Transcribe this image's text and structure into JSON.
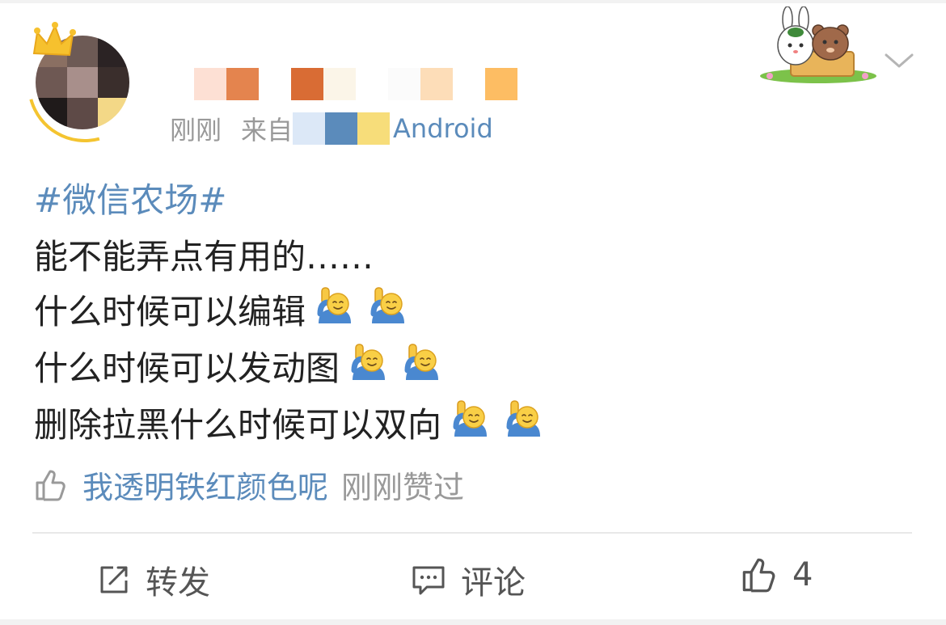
{
  "post": {
    "time": "刚刚",
    "source_prefix": "来自",
    "source_device": "Android",
    "topic": "#微信农场#",
    "lines": [
      "能不能弄点有用的……",
      "什么时候可以编辑",
      "什么时候可以发动图",
      "删除拉黑什么时候可以双向"
    ],
    "emoji_per_line": [
      0,
      2,
      2,
      2
    ],
    "emoji_name": "raising-hand-emoji"
  },
  "likes": {
    "liker": "我透明铁红颜色呢",
    "when": "刚刚赞过"
  },
  "actions": {
    "repost_label": "转发",
    "comment_label": "评论",
    "like_count": "4"
  },
  "colors": {
    "link": "#5b8bbb",
    "meta": "#999999",
    "text": "#222222",
    "action": "#555555"
  },
  "mosaic": {
    "avatar": [
      "#8a6f62",
      "#6d5a55",
      "#2b2324",
      "#6e5853",
      "#a88f8b",
      "#3a2e2c",
      "#1f1a1a",
      "#5e4a47",
      "#f3d887"
    ],
    "name": [
      "#ffffff",
      "#fde0d4",
      "#e4844e",
      "#ffffff",
      "#d96c34",
      "#fbf5e8",
      "#ffffff",
      "#fbfbfb",
      "#fdddb8",
      "#ffffff",
      "#fdbd63"
    ],
    "source": [
      "#dce8f7",
      "#5b8bbb",
      "#f7dd7a"
    ]
  }
}
